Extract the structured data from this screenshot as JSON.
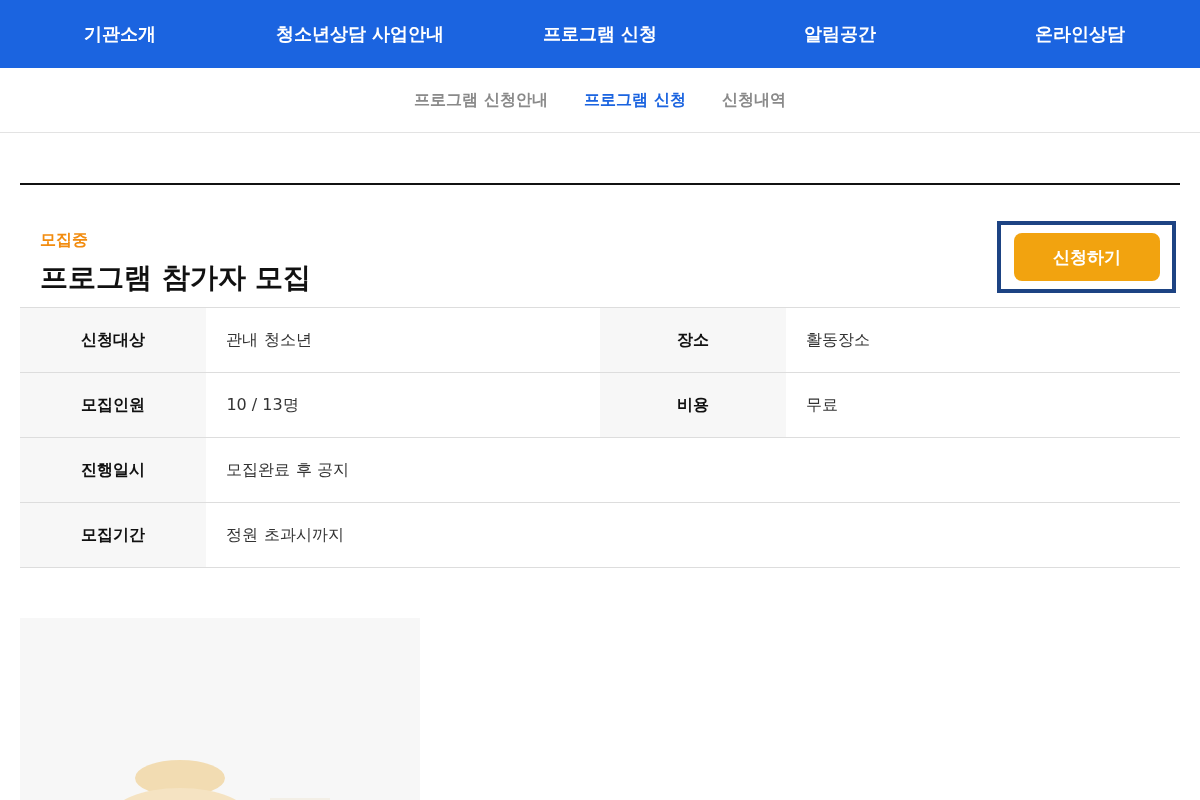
{
  "nav": [
    {
      "label": "기관소개"
    },
    {
      "label": "청소년상담 사업안내"
    },
    {
      "label": "프로그램 신청"
    },
    {
      "label": "알림공간"
    },
    {
      "label": "온라인상담"
    }
  ],
  "subnav": [
    {
      "label": "프로그램 신청안내",
      "selected": false
    },
    {
      "label": "프로그램 신청",
      "selected": true
    },
    {
      "label": "신청내역",
      "selected": false
    }
  ],
  "program": {
    "status": "모집중",
    "title": "프로그램 참가자 모집",
    "apply_button": {
      "label": "신청하기",
      "focused": true
    }
  },
  "info_rows": [
    [
      {
        "label": "신청대상",
        "value": "관내 청소년"
      },
      {
        "label": "장소",
        "value": "활동장소"
      }
    ],
    [
      {
        "label": "모집인원",
        "value": "10 / 13명"
      },
      {
        "label": "비용",
        "value": "무료"
      }
    ],
    [
      {
        "label": "진행일시",
        "value": "모집완료 후 공지"
      }
    ],
    [
      {
        "label": "모집기간",
        "value": "정원 초과시까지"
      }
    ]
  ],
  "poster": {
    "kind": "picture"
  }
}
